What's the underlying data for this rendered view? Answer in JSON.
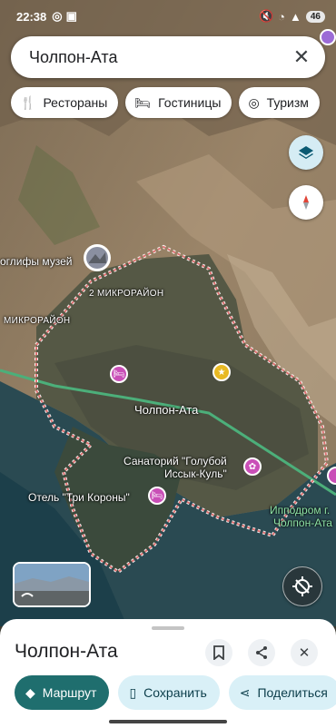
{
  "status_bar": {
    "time": "22:38",
    "battery": "46"
  },
  "search": {
    "query": "Чолпон-Ата",
    "clear_icon": "close-icon"
  },
  "chips": [
    {
      "icon": "fork-knife-icon",
      "label": "Рестораны"
    },
    {
      "icon": "bed-icon",
      "label": "Гостиницы"
    },
    {
      "icon": "camera-icon",
      "label": "Туризм"
    }
  ],
  "map": {
    "labels": {
      "petroglyphs": "оглифы музей",
      "micro2": "2 МИКРОРАЙОН",
      "micro": "МИКРОРАЙОН",
      "city": "Чолпон-Ата",
      "sanatorium_line1": "Санаторий \"Голубой",
      "sanatorium_line2": "Иссык-Куль\"",
      "hotel": "Отель \"Три Короны\"",
      "hippodrome_line1": "Ипподром г.",
      "hippodrome_line2": "Чолпон-Ата"
    },
    "colors": {
      "boundary": "#e07070",
      "road": "#4caf7a",
      "water": "#1c3f4a"
    }
  },
  "sheet": {
    "title": "Чолпон-Ата",
    "actions": [
      {
        "icon": "directions-icon",
        "label": "Маршрут"
      },
      {
        "icon": "bookmark-icon",
        "label": "Сохранить"
      },
      {
        "icon": "share-icon",
        "label": "Поделиться"
      }
    ]
  }
}
